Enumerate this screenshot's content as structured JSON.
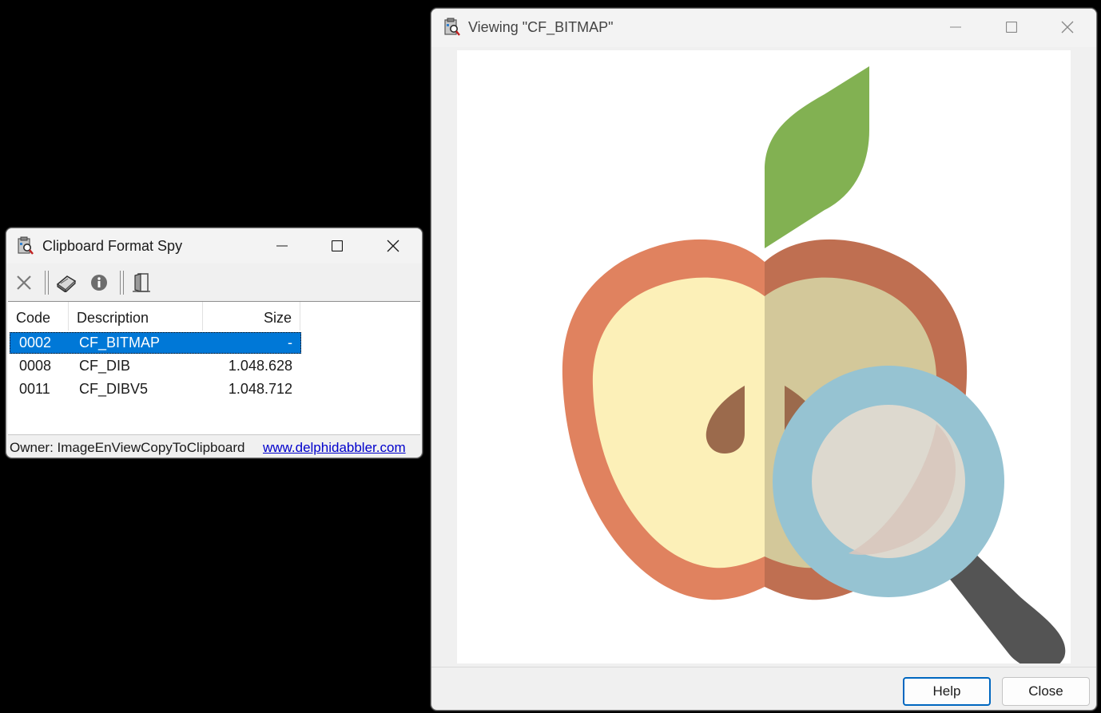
{
  "spy_window": {
    "title": "Clipboard Format Spy",
    "toolbar": {
      "clear_icon": "close-x-icon",
      "view_icon": "book-icon",
      "info_icon": "info-icon",
      "exit_icon": "door-exit-icon"
    },
    "columns": [
      "Code",
      "Description",
      "Size"
    ],
    "rows": [
      {
        "code": "0002",
        "description": "CF_BITMAP",
        "size": "-",
        "selected": true
      },
      {
        "code": "0008",
        "description": "CF_DIB",
        "size": "1.048.628",
        "selected": false
      },
      {
        "code": "0011",
        "description": "CF_DIBV5",
        "size": "1.048.712",
        "selected": false
      }
    ],
    "status": {
      "owner": "Owner: ImageEnViewCopyToClipboard",
      "link": "www.delphidabbler.com"
    }
  },
  "viewer_window": {
    "title": "Viewing \"CF_BITMAP\"",
    "image_subject": "apple-with-magnifying-glass-illustration",
    "buttons": {
      "help": "Help",
      "close": "Close"
    }
  },
  "colors": {
    "selection": "#0078d7",
    "link": "#0000cc",
    "default_button_border": "#0067c0"
  }
}
